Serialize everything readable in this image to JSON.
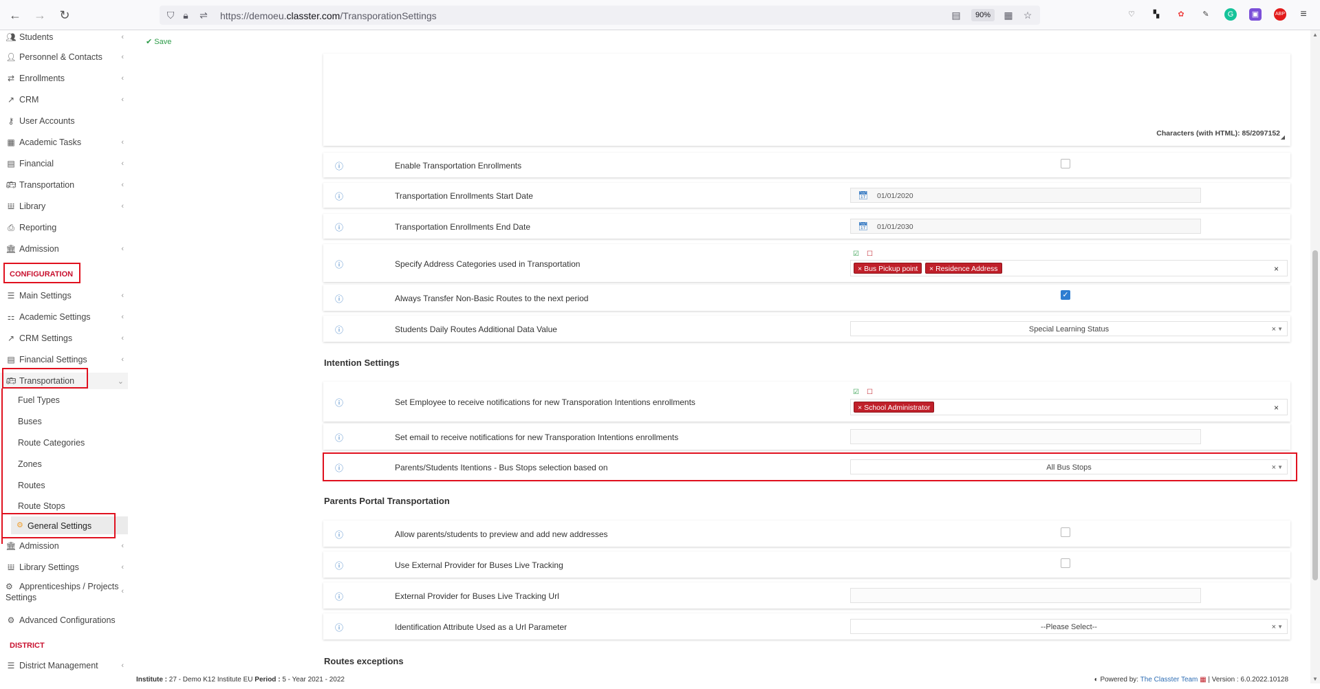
{
  "browser": {
    "url_prefix": "https://demoeu.",
    "url_domain": "classter.com",
    "url_path": "/TransporationSettings",
    "zoom": "90%"
  },
  "sidebar": {
    "items": [
      {
        "label": "Students",
        "icon": "students-icon"
      },
      {
        "label": "Personnel & Contacts",
        "icon": "personnel-icon"
      },
      {
        "label": "Enrollments",
        "icon": "enrollments-icon"
      },
      {
        "label": "CRM",
        "icon": "crm-icon"
      },
      {
        "label": "User Accounts",
        "icon": "key-icon"
      },
      {
        "label": "Academic Tasks",
        "icon": "grid-icon"
      },
      {
        "label": "Financial",
        "icon": "money-icon"
      },
      {
        "label": "Transportation",
        "icon": "bus-icon"
      },
      {
        "label": "Library",
        "icon": "books-icon"
      },
      {
        "label": "Reporting",
        "icon": "print-icon"
      },
      {
        "label": "Admission",
        "icon": "bank-icon"
      }
    ],
    "config_header": "CONFIGURATION",
    "config_items": [
      {
        "label": "Main Settings",
        "icon": "sliders-icon"
      },
      {
        "label": "Academic Settings",
        "icon": "sitemap-icon"
      },
      {
        "label": "CRM Settings",
        "icon": "crm-icon"
      },
      {
        "label": "Financial Settings",
        "icon": "money-icon"
      },
      {
        "label": "Transportation",
        "icon": "bus-icon"
      }
    ],
    "transport_subitems": [
      "Fuel Types",
      "Buses",
      "Route Categories",
      "Zones",
      "Routes",
      "Route Stops"
    ],
    "active_item": "General Settings",
    "after_items": [
      {
        "label": "Admission",
        "icon": "bank-icon"
      },
      {
        "label": "Library Settings",
        "icon": "books-icon"
      },
      {
        "label": "Apprenticeships / Projects",
        "label2": "Settings",
        "icon": "gear-icon"
      },
      {
        "label": "Advanced Configurations",
        "icon": "gears-icon"
      }
    ],
    "district_header": "DISTRICT",
    "district_items": [
      {
        "label": "District Management",
        "icon": "list-icon"
      }
    ]
  },
  "toolbar": {
    "save_label": "Save"
  },
  "editor": {
    "char_count": "Characters (with HTML): 85/2097152"
  },
  "settings_rows": {
    "enable_enrollments": "Enable Transportation Enrollments",
    "start_date": {
      "label": "Transportation Enrollments Start Date",
      "value": "01/01/2020"
    },
    "end_date": {
      "label": "Transportation Enrollments End Date",
      "value": "01/01/2030"
    },
    "address_categories": {
      "label": "Specify Address Categories used in Transportation",
      "tags": [
        "Bus Pickup point",
        "Residence Address"
      ]
    },
    "transfer_routes": {
      "label": "Always Transfer Non-Basic Routes to the next period",
      "checked": true
    },
    "daily_routes": {
      "label": "Students Daily Routes Additional Data Value",
      "value": "Special Learning Status"
    }
  },
  "intention_settings": {
    "title": "Intention Settings",
    "employee_notify": {
      "label": "Set Employee to receive notifications for new Transporation Intentions enrollments",
      "tags": [
        "School Administrator"
      ]
    },
    "email_notify": {
      "label": "Set email to receive notifications for new Transporation Intentions enrollments"
    },
    "bus_stops": {
      "label": "Parents/Students Itentions - Bus Stops selection based on",
      "value": "All Bus Stops"
    }
  },
  "parents_portal": {
    "title": "Parents Portal Transportation",
    "preview_addresses": "Allow parents/students to preview and add new addresses",
    "external_provider": "Use External Provider for Buses Live Tracking",
    "tracking_url": "External Provider for Buses Live Tracking Url",
    "id_attribute": {
      "label": "Identification Attribute Used as a Url Parameter",
      "value": "--Please Select--"
    }
  },
  "routes_exceptions_title": "Routes exceptions",
  "status": {
    "institute_label": "Institute :",
    "institute_value": "27 - Demo K12 Institute EU",
    "period_label": "Period :",
    "period_value": "5 - Year 2021 - 2022",
    "powered_label": "Powered by:",
    "powered_link": "The Classter Team",
    "version": "| Version : 6.0.2022.10128"
  },
  "colors": {
    "accent_red": "#c0202a",
    "info_blue": "#3b7dc4",
    "save_green": "#2b9b47"
  }
}
